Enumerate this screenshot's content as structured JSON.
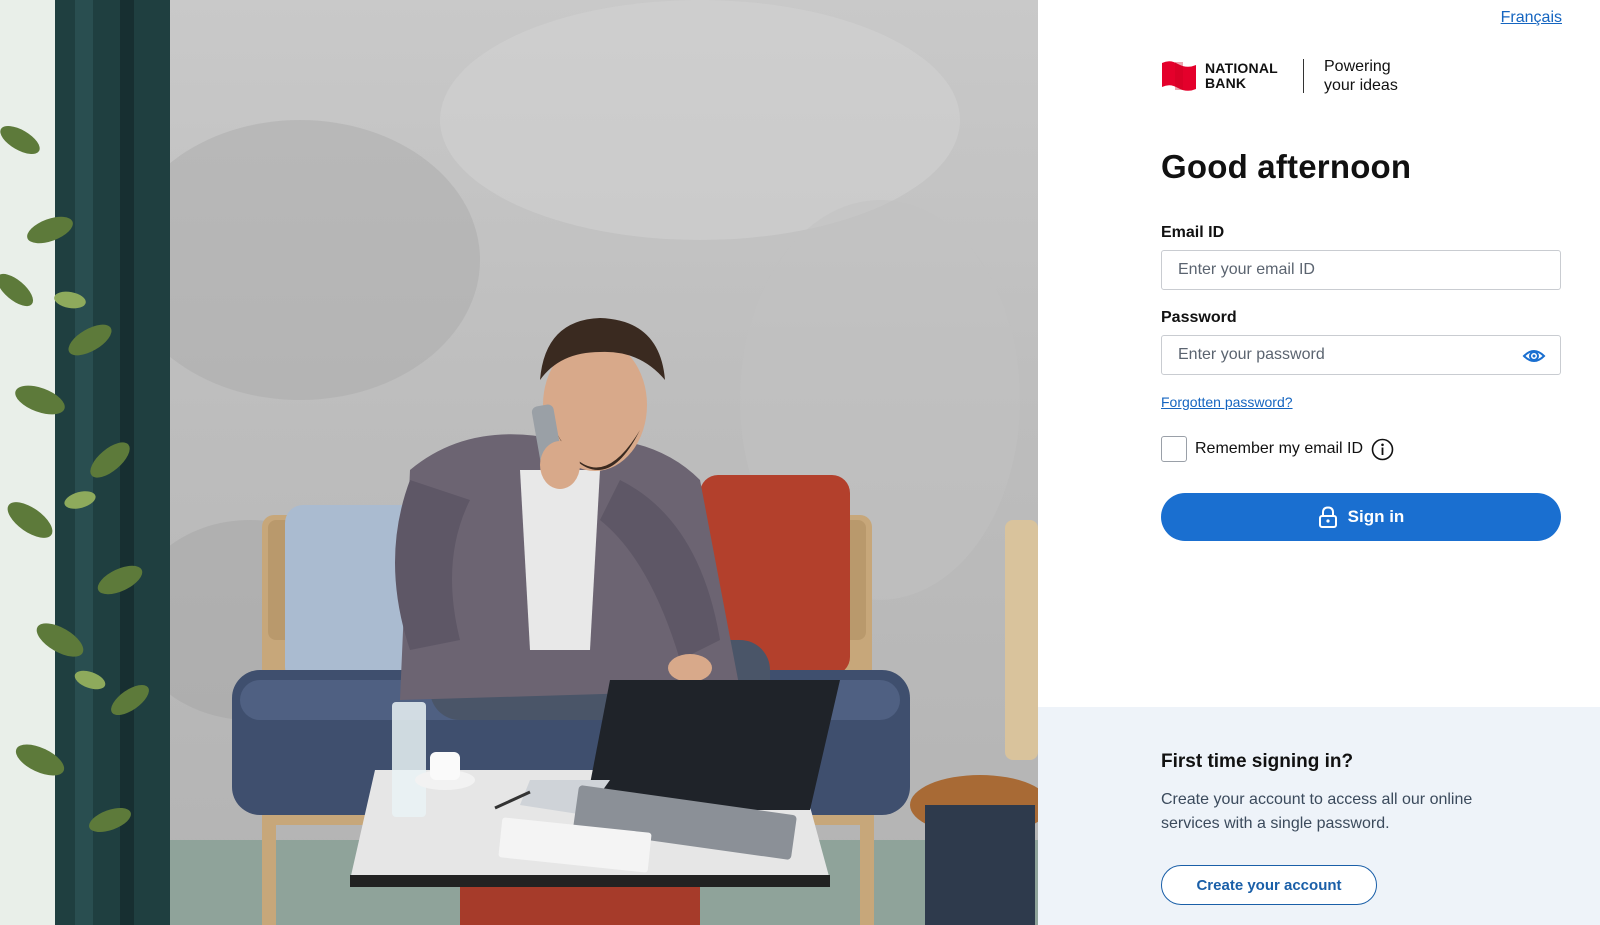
{
  "header": {
    "language_link": "Français"
  },
  "brand": {
    "name_line1": "NATIONAL",
    "name_line2": "BANK",
    "tagline_line1": "Powering",
    "tagline_line2": "your ideas",
    "flag_color": "#e4002b"
  },
  "login": {
    "greeting": "Good afternoon",
    "email": {
      "label": "Email ID",
      "placeholder": "Enter your email ID",
      "value": ""
    },
    "password": {
      "label": "Password",
      "placeholder": "Enter your password",
      "value": "",
      "toggle_icon": "eye-icon"
    },
    "forgot_link": "Forgotten password?",
    "remember": {
      "label": "Remember my email ID",
      "checked": false,
      "info_icon": "info-icon"
    },
    "signin_button": "Sign in",
    "signin_icon": "lock-icon",
    "accent_color": "#1a6fd0"
  },
  "first_time": {
    "title": "First time signing in?",
    "text": "Create your account to access all our online services with a single password.",
    "button": "Create your account"
  }
}
